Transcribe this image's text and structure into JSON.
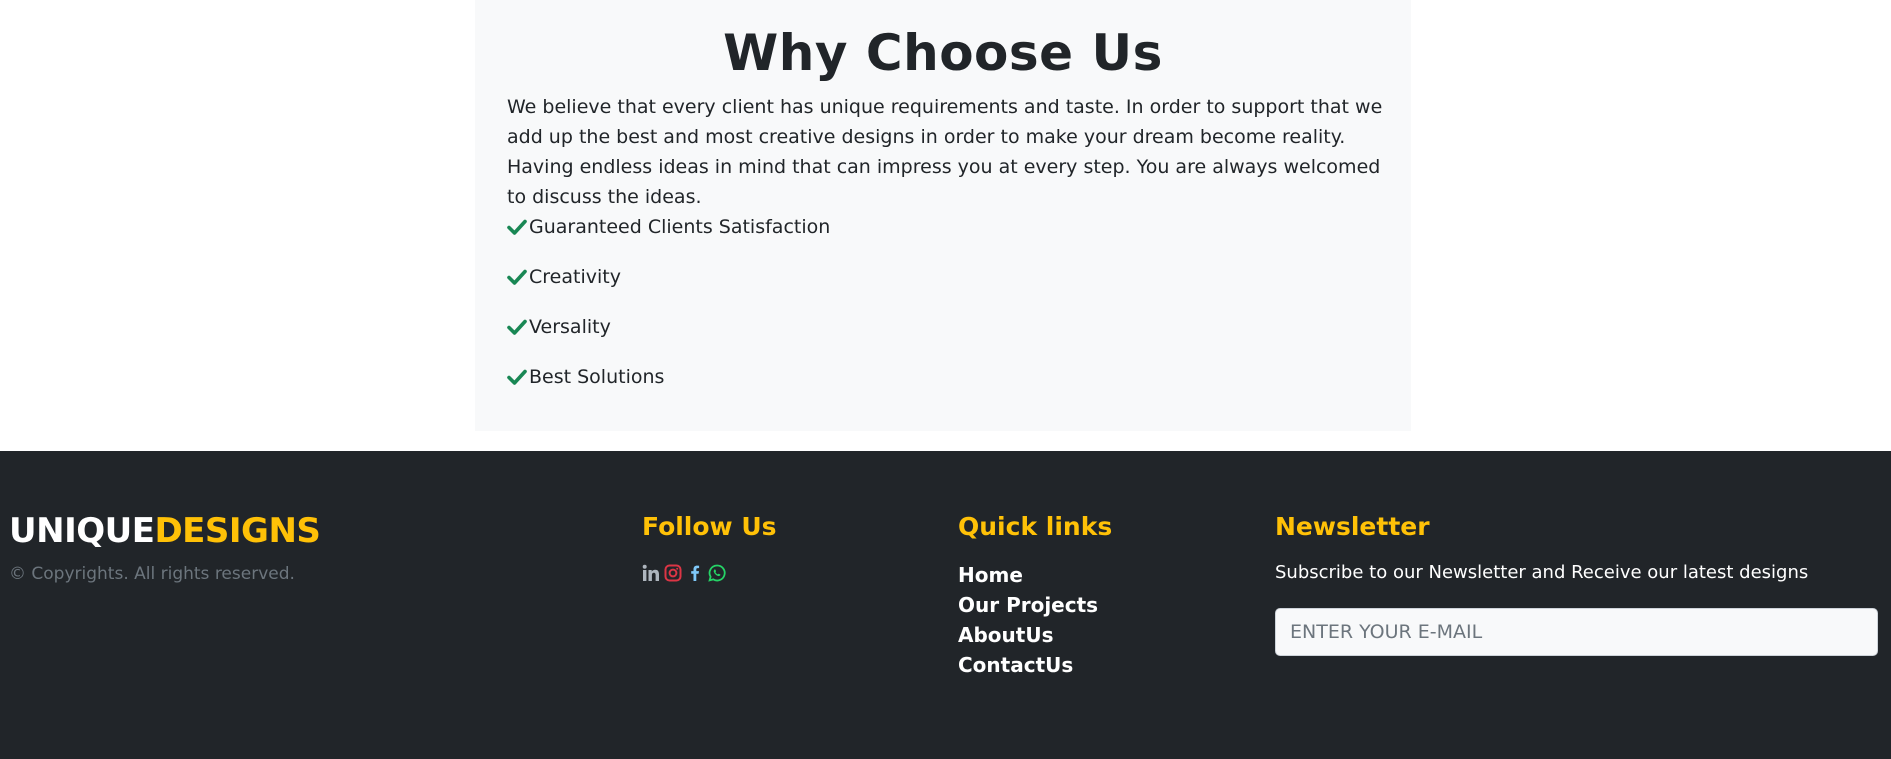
{
  "why": {
    "title": "Why Choose Us",
    "text": "We believe that every client has unique requirements and taste. In order to support that we add up the best and most creative designs in order to make your dream become reality. Having endless ideas in mind that can impress you at every step. You are always welcomed to discuss the ideas.",
    "features": [
      "Guaranteed Clients Satisfaction",
      "Creativity",
      "Versality",
      "Best Solutions"
    ]
  },
  "footer": {
    "brand_a": "UNIQUE",
    "brand_b": "DESIGNS",
    "copyright": "© Copyrights. All rights reserved.",
    "follow_title": "Follow Us",
    "social_icons": [
      "linkedin-icon",
      "instagram-icon",
      "facebook-icon",
      "whatsapp-icon"
    ],
    "links_title": "Quick links",
    "links": [
      "Home",
      "Our Projects",
      "AboutUs",
      "ContactUs"
    ],
    "newsletter_title": "Newsletter",
    "newsletter_text": "Subscribe to our Newsletter and Receive our latest designs",
    "email_placeholder": "ENTER YOUR E-MAIL"
  },
  "colors": {
    "accent": "#ffc107",
    "footer_bg": "#212529",
    "section_bg": "#f8f9fa",
    "check": "#198754"
  }
}
